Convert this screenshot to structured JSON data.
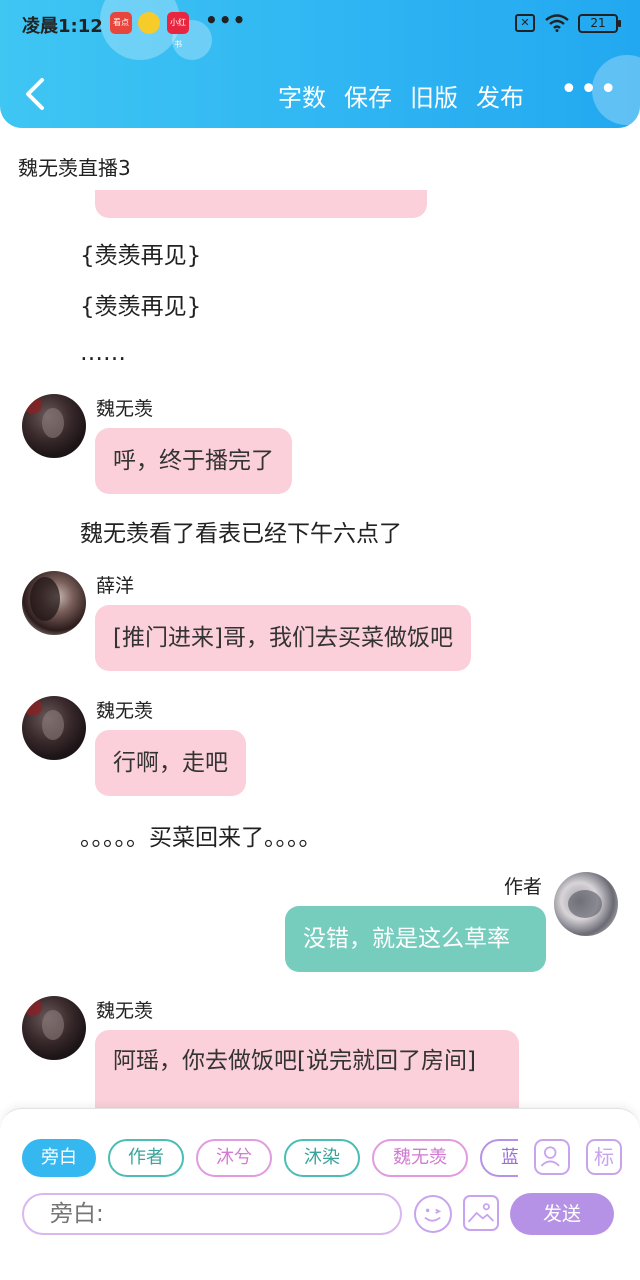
{
  "status_bar": {
    "time": "凌晨1:12",
    "apps": [
      "看点",
      "",
      "小红书"
    ],
    "more": "•••",
    "battery": "21"
  },
  "header": {
    "actions": [
      "字数",
      "保存",
      "旧版",
      "发布"
    ],
    "more": "•••"
  },
  "doc_title": "魏无羡直播3",
  "messages": [
    {
      "type": "narration",
      "text": "{羡羡再见}"
    },
    {
      "type": "narration",
      "text": "{羡羡再见}"
    },
    {
      "type": "narration",
      "text": "……"
    },
    {
      "type": "bubble",
      "name": "魏无羡",
      "text": "呼，终于播完了"
    },
    {
      "type": "narration",
      "text": "魏无羡看了看表已经下午六点了"
    },
    {
      "type": "bubble",
      "name": "薛洋",
      "text": "[推门进来]哥，我们去买菜做饭吧"
    },
    {
      "type": "bubble",
      "name": "魏无羡",
      "text": "行啊，走吧"
    },
    {
      "type": "narration",
      "text": "。。。。。买菜回来了。。。。"
    },
    {
      "type": "bubble",
      "name": "作者",
      "text": "没错，就是这么草率",
      "align": "right"
    },
    {
      "type": "bubble",
      "name": "魏无羡",
      "text": "阿瑶，你去做饭吧[说完就回了房间]"
    }
  ],
  "bottom": {
    "roles": [
      "旁白",
      "作者",
      "沐兮",
      "沐染",
      "魏无羡",
      "蓝"
    ],
    "tag_label": "标",
    "input_placeholder": "旁白:",
    "send_label": "发送"
  },
  "colors": {
    "header": "#2fb5f2",
    "bubble_pink": "#fbd0da",
    "bubble_author": "#76cdbe",
    "send": "#b592e6"
  }
}
